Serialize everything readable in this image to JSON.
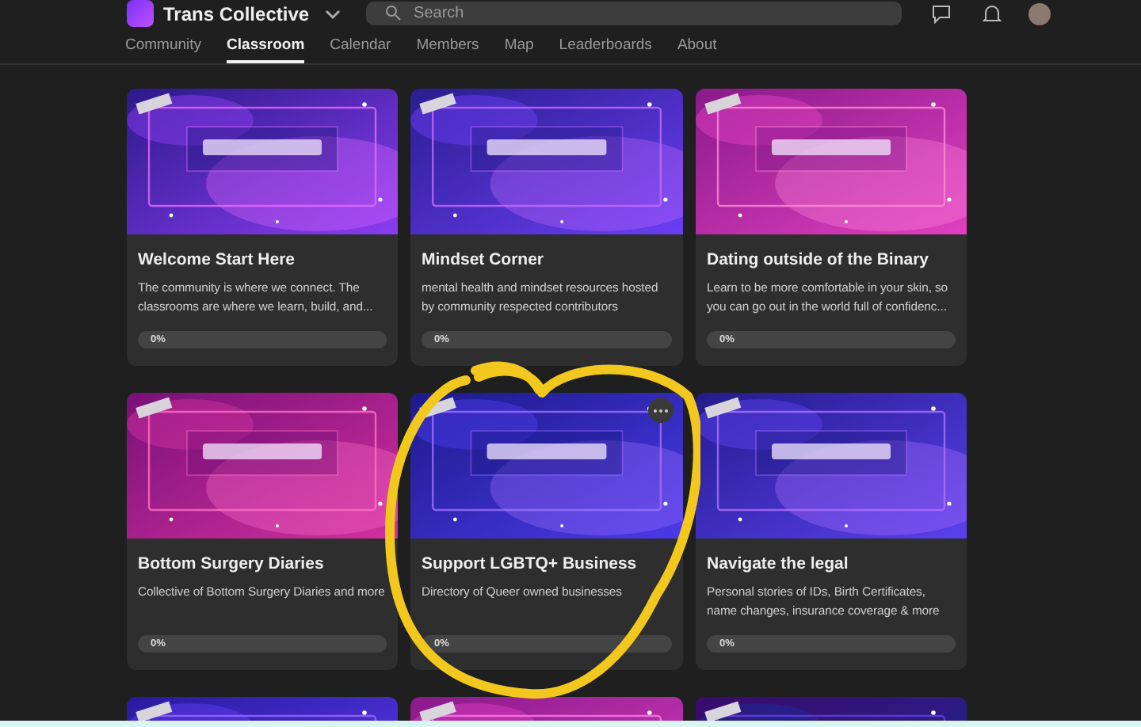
{
  "header": {
    "group_name": "Trans Collective",
    "search": {
      "placeholder": "Search"
    }
  },
  "tabs": [
    {
      "label": "Community",
      "selected": false
    },
    {
      "label": "Classroom",
      "selected": true
    },
    {
      "label": "Calendar",
      "selected": false
    },
    {
      "label": "Members",
      "selected": false
    },
    {
      "label": "Map",
      "selected": false
    },
    {
      "label": "Leaderboards",
      "selected": false
    },
    {
      "label": "About",
      "selected": false
    }
  ],
  "courses": [
    {
      "cover": {
        "kind": "picture"
      },
      "title": "Welcome Start Here",
      "description": "The community is where we connect. The classrooms are where we learn, build, and...",
      "progress": {
        "level": 0,
        "reading": "0%"
      }
    },
    {
      "cover": {
        "kind": "picture"
      },
      "title": "Mindset Corner",
      "description": "mental health and mindset resources hosted by community respected contributors",
      "progress": {
        "level": 0,
        "reading": "0%"
      }
    },
    {
      "cover": {
        "kind": "picture"
      },
      "title": "Dating outside of the Binary",
      "description": "Learn to be more comfortable in your skin, so you can go out in the world full of confidenc...",
      "progress": {
        "level": 0,
        "reading": "0%"
      }
    },
    {
      "cover": {
        "kind": "picture"
      },
      "title": "Bottom Surgery Diaries",
      "description": "Collective of Bottom Surgery Diaries and more",
      "progress": {
        "level": 0,
        "reading": "0%"
      }
    },
    {
      "cover": {
        "kind": "picture"
      },
      "title": "Support LGBTQ+ Business",
      "description": "Directory of Queer owned businesses",
      "progress": {
        "level": 0,
        "reading": "0%"
      },
      "menu": true
    },
    {
      "cover": {
        "kind": "picture"
      },
      "title": "Navigate the legal",
      "description": "Personal stories of IDs, Birth Certificates, name changes, insurance coverage & more",
      "progress": {
        "level": 0,
        "reading": "0%"
      }
    },
    {
      "cover": {
        "kind": "picture"
      }
    },
    {
      "cover": {
        "kind": "picture"
      }
    },
    {
      "cover": {
        "kind": "picture"
      }
    }
  ],
  "annotation": {
    "kind": "heart"
  }
}
